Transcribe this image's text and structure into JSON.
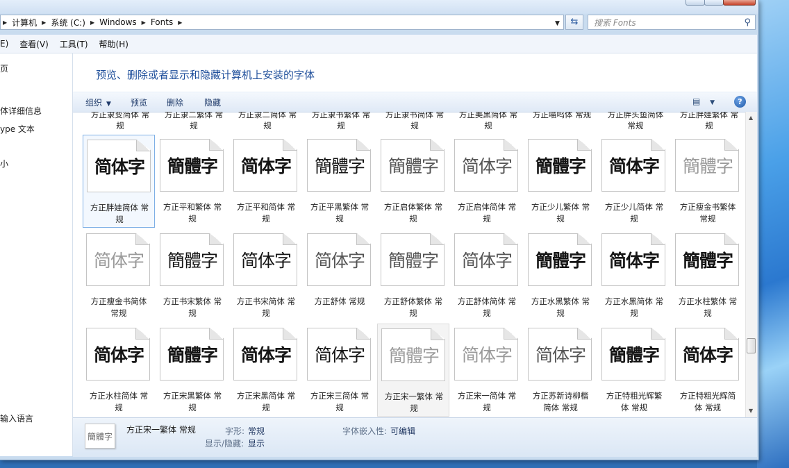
{
  "window": {
    "breadcrumbs": [
      "计算机",
      "系统 (C:)",
      "Windows",
      "Fonts"
    ],
    "search_placeholder": "搜索 Fonts"
  },
  "menubar": {
    "items": [
      "E)",
      "查看(V)",
      "工具(T)",
      "帮助(H)"
    ]
  },
  "navpane": {
    "items": [
      "页",
      "体详细信息",
      "ype 文本",
      "小",
      "输入语言"
    ]
  },
  "headline": "预览、删除或者显示和隐藏计算机上安装的字体",
  "toolbar": {
    "organize": "组织",
    "preview": "预览",
    "delete": "删除",
    "hide": "隐藏"
  },
  "partial_row": [
    [
      "方正隶变简体 常",
      "规"
    ],
    [
      "方正隶二繁体 常",
      "规"
    ],
    [
      "方正隶二简体 常",
      "规"
    ],
    [
      "方正隶书繁体 常",
      "规"
    ],
    [
      "方正隶书简体 常",
      "规"
    ],
    [
      "方正美黑简体 常",
      "规"
    ],
    [
      "方正喵呜体 常规",
      ""
    ],
    [
      "方正胖头鱼简体",
      "常规"
    ],
    [
      "方正胖娃繁体 常",
      "规"
    ]
  ],
  "rows": [
    [
      {
        "sample": "简体字",
        "style": "bold",
        "name": [
          "方正胖娃简体 常",
          "规"
        ]
      },
      {
        "sample": "簡體字",
        "style": "bold",
        "name": [
          "方正平和繁体 常",
          "规"
        ]
      },
      {
        "sample": "简体字",
        "style": "bold",
        "name": [
          "方正平和简体 常",
          "规"
        ]
      },
      {
        "sample": "簡體字",
        "style": "normal",
        "name": [
          "方正平黑繁体 常",
          "规"
        ]
      },
      {
        "sample": "簡體字",
        "style": "thin",
        "name": [
          "方正启体繁体 常",
          "规"
        ]
      },
      {
        "sample": "简体字",
        "style": "thin",
        "name": [
          "方正启体简体 常",
          "规"
        ]
      },
      {
        "sample": "簡體字",
        "style": "bold",
        "name": [
          "方正少儿繁体 常",
          "规"
        ]
      },
      {
        "sample": "简体字",
        "style": "bold",
        "name": [
          "方正少儿简体 常",
          "规"
        ]
      },
      {
        "sample": "簡體字",
        "style": "light",
        "name": [
          "方正瘦金书繁体",
          "常规"
        ]
      }
    ],
    [
      {
        "sample": "简体字",
        "style": "light",
        "name": [
          "方正瘦金书简体",
          "常规"
        ]
      },
      {
        "sample": "簡體字",
        "style": "normal",
        "name": [
          "方正书宋繁体 常",
          "规"
        ]
      },
      {
        "sample": "简体字",
        "style": "normal",
        "name": [
          "方正书宋简体 常",
          "规"
        ]
      },
      {
        "sample": "简体字",
        "style": "thin",
        "name": [
          "方正舒体 常规",
          ""
        ]
      },
      {
        "sample": "簡體字",
        "style": "thin",
        "name": [
          "方正舒体繁体 常",
          "规"
        ]
      },
      {
        "sample": "简体字",
        "style": "thin",
        "name": [
          "方正舒体简体 常",
          "规"
        ]
      },
      {
        "sample": "簡體字",
        "style": "bold",
        "name": [
          "方正水黑繁体 常",
          "规"
        ]
      },
      {
        "sample": "简体字",
        "style": "bold",
        "name": [
          "方正水黑简体 常",
          "规"
        ]
      },
      {
        "sample": "簡體字",
        "style": "bold",
        "name": [
          "方正水柱繁体 常",
          "规"
        ]
      }
    ],
    [
      {
        "sample": "简体字",
        "style": "bold",
        "name": [
          "方正水柱简体 常",
          "规"
        ]
      },
      {
        "sample": "簡體字",
        "style": "bold",
        "name": [
          "方正宋黑繁体 常",
          "规"
        ]
      },
      {
        "sample": "简体字",
        "style": "bold",
        "name": [
          "方正宋黑简体 常",
          "规"
        ]
      },
      {
        "sample": "简体字",
        "style": "normal",
        "name": [
          "方正宋三简体 常",
          "规"
        ]
      },
      {
        "sample": "簡體字",
        "style": "light",
        "name": [
          "方正宋一繁体 常",
          "规"
        ]
      },
      {
        "sample": "简体字",
        "style": "light",
        "name": [
          "方正宋一简体 常",
          "规"
        ]
      },
      {
        "sample": "简体字",
        "style": "thin",
        "name": [
          "方正苏新诗柳楷",
          "简体 常规"
        ]
      },
      {
        "sample": "簡體字",
        "style": "bold",
        "name": [
          "方正特粗光辉繁",
          "体 常规"
        ]
      },
      {
        "sample": "简体字",
        "style": "bold",
        "name": [
          "方正特粗光辉简",
          "体 常规"
        ]
      }
    ]
  ],
  "details": {
    "thumb_sample": "簡體字",
    "name": "方正宋一繁体 常规",
    "style_label": "字形:",
    "style_value": "常规",
    "visibility_label": "显示/隐藏:",
    "visibility_value": "显示",
    "embed_label": "字体嵌入性:",
    "embed_value": "可编辑"
  }
}
